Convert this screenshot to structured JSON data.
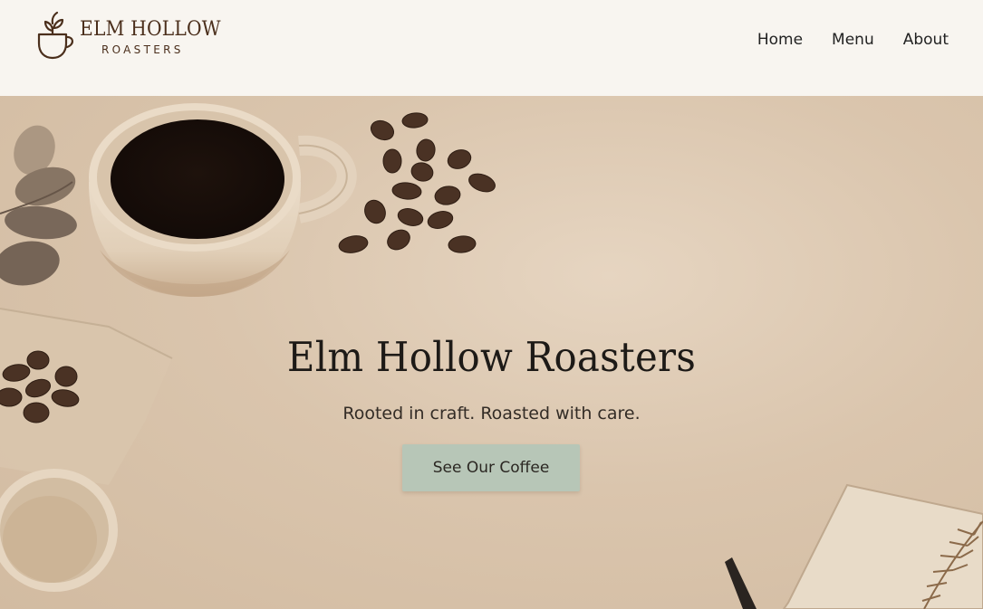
{
  "brand": {
    "name": "ELM HOLLOW",
    "subtitle": "ROASTERS",
    "color": "#4b2f1c"
  },
  "nav": {
    "items": [
      {
        "label": "Home"
      },
      {
        "label": "Menu"
      },
      {
        "label": "About"
      }
    ]
  },
  "hero": {
    "title": "Elm Hollow Roasters",
    "tagline": "Rooted in craft. Roasted with care.",
    "cta_label": "See Our Coffee",
    "cta_color": "#b7c6b7",
    "background_color": "#dac5ad"
  },
  "icons": {
    "logo": "coffee-cup-leaf-icon"
  }
}
